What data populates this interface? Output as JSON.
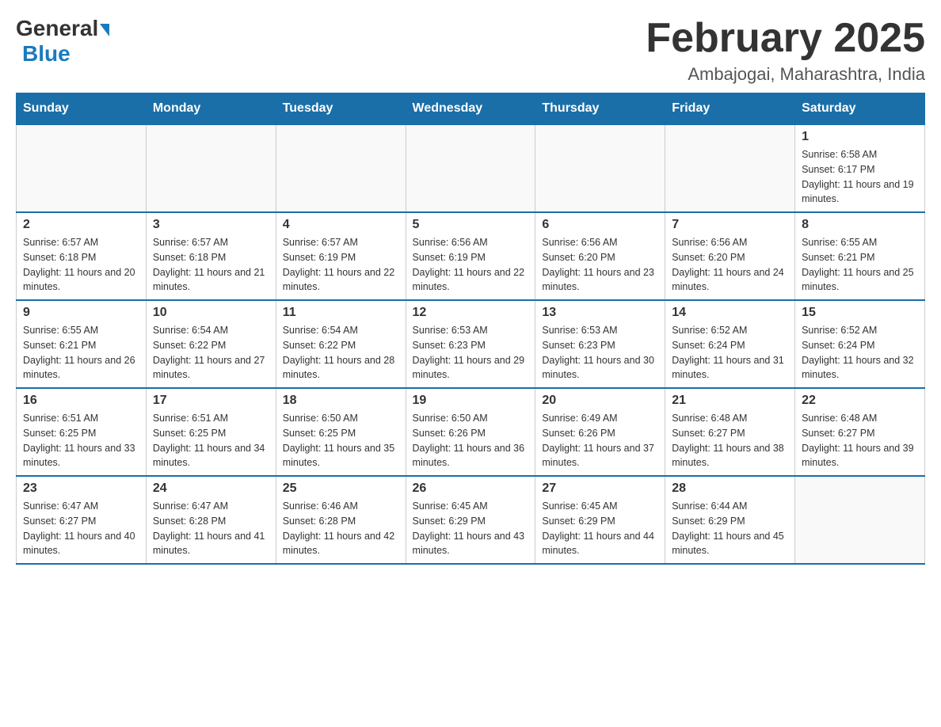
{
  "logo": {
    "general": "General",
    "blue": "Blue"
  },
  "header": {
    "month": "February 2025",
    "location": "Ambajogai, Maharashtra, India"
  },
  "weekdays": [
    "Sunday",
    "Monday",
    "Tuesday",
    "Wednesday",
    "Thursday",
    "Friday",
    "Saturday"
  ],
  "weeks": [
    [
      {
        "day": "",
        "info": ""
      },
      {
        "day": "",
        "info": ""
      },
      {
        "day": "",
        "info": ""
      },
      {
        "day": "",
        "info": ""
      },
      {
        "day": "",
        "info": ""
      },
      {
        "day": "",
        "info": ""
      },
      {
        "day": "1",
        "info": "Sunrise: 6:58 AM\nSunset: 6:17 PM\nDaylight: 11 hours and 19 minutes."
      }
    ],
    [
      {
        "day": "2",
        "info": "Sunrise: 6:57 AM\nSunset: 6:18 PM\nDaylight: 11 hours and 20 minutes."
      },
      {
        "day": "3",
        "info": "Sunrise: 6:57 AM\nSunset: 6:18 PM\nDaylight: 11 hours and 21 minutes."
      },
      {
        "day": "4",
        "info": "Sunrise: 6:57 AM\nSunset: 6:19 PM\nDaylight: 11 hours and 22 minutes."
      },
      {
        "day": "5",
        "info": "Sunrise: 6:56 AM\nSunset: 6:19 PM\nDaylight: 11 hours and 22 minutes."
      },
      {
        "day": "6",
        "info": "Sunrise: 6:56 AM\nSunset: 6:20 PM\nDaylight: 11 hours and 23 minutes."
      },
      {
        "day": "7",
        "info": "Sunrise: 6:56 AM\nSunset: 6:20 PM\nDaylight: 11 hours and 24 minutes."
      },
      {
        "day": "8",
        "info": "Sunrise: 6:55 AM\nSunset: 6:21 PM\nDaylight: 11 hours and 25 minutes."
      }
    ],
    [
      {
        "day": "9",
        "info": "Sunrise: 6:55 AM\nSunset: 6:21 PM\nDaylight: 11 hours and 26 minutes."
      },
      {
        "day": "10",
        "info": "Sunrise: 6:54 AM\nSunset: 6:22 PM\nDaylight: 11 hours and 27 minutes."
      },
      {
        "day": "11",
        "info": "Sunrise: 6:54 AM\nSunset: 6:22 PM\nDaylight: 11 hours and 28 minutes."
      },
      {
        "day": "12",
        "info": "Sunrise: 6:53 AM\nSunset: 6:23 PM\nDaylight: 11 hours and 29 minutes."
      },
      {
        "day": "13",
        "info": "Sunrise: 6:53 AM\nSunset: 6:23 PM\nDaylight: 11 hours and 30 minutes."
      },
      {
        "day": "14",
        "info": "Sunrise: 6:52 AM\nSunset: 6:24 PM\nDaylight: 11 hours and 31 minutes."
      },
      {
        "day": "15",
        "info": "Sunrise: 6:52 AM\nSunset: 6:24 PM\nDaylight: 11 hours and 32 minutes."
      }
    ],
    [
      {
        "day": "16",
        "info": "Sunrise: 6:51 AM\nSunset: 6:25 PM\nDaylight: 11 hours and 33 minutes."
      },
      {
        "day": "17",
        "info": "Sunrise: 6:51 AM\nSunset: 6:25 PM\nDaylight: 11 hours and 34 minutes."
      },
      {
        "day": "18",
        "info": "Sunrise: 6:50 AM\nSunset: 6:25 PM\nDaylight: 11 hours and 35 minutes."
      },
      {
        "day": "19",
        "info": "Sunrise: 6:50 AM\nSunset: 6:26 PM\nDaylight: 11 hours and 36 minutes."
      },
      {
        "day": "20",
        "info": "Sunrise: 6:49 AM\nSunset: 6:26 PM\nDaylight: 11 hours and 37 minutes."
      },
      {
        "day": "21",
        "info": "Sunrise: 6:48 AM\nSunset: 6:27 PM\nDaylight: 11 hours and 38 minutes."
      },
      {
        "day": "22",
        "info": "Sunrise: 6:48 AM\nSunset: 6:27 PM\nDaylight: 11 hours and 39 minutes."
      }
    ],
    [
      {
        "day": "23",
        "info": "Sunrise: 6:47 AM\nSunset: 6:27 PM\nDaylight: 11 hours and 40 minutes."
      },
      {
        "day": "24",
        "info": "Sunrise: 6:47 AM\nSunset: 6:28 PM\nDaylight: 11 hours and 41 minutes."
      },
      {
        "day": "25",
        "info": "Sunrise: 6:46 AM\nSunset: 6:28 PM\nDaylight: 11 hours and 42 minutes."
      },
      {
        "day": "26",
        "info": "Sunrise: 6:45 AM\nSunset: 6:29 PM\nDaylight: 11 hours and 43 minutes."
      },
      {
        "day": "27",
        "info": "Sunrise: 6:45 AM\nSunset: 6:29 PM\nDaylight: 11 hours and 44 minutes."
      },
      {
        "day": "28",
        "info": "Sunrise: 6:44 AM\nSunset: 6:29 PM\nDaylight: 11 hours and 45 minutes."
      },
      {
        "day": "",
        "info": ""
      }
    ]
  ]
}
